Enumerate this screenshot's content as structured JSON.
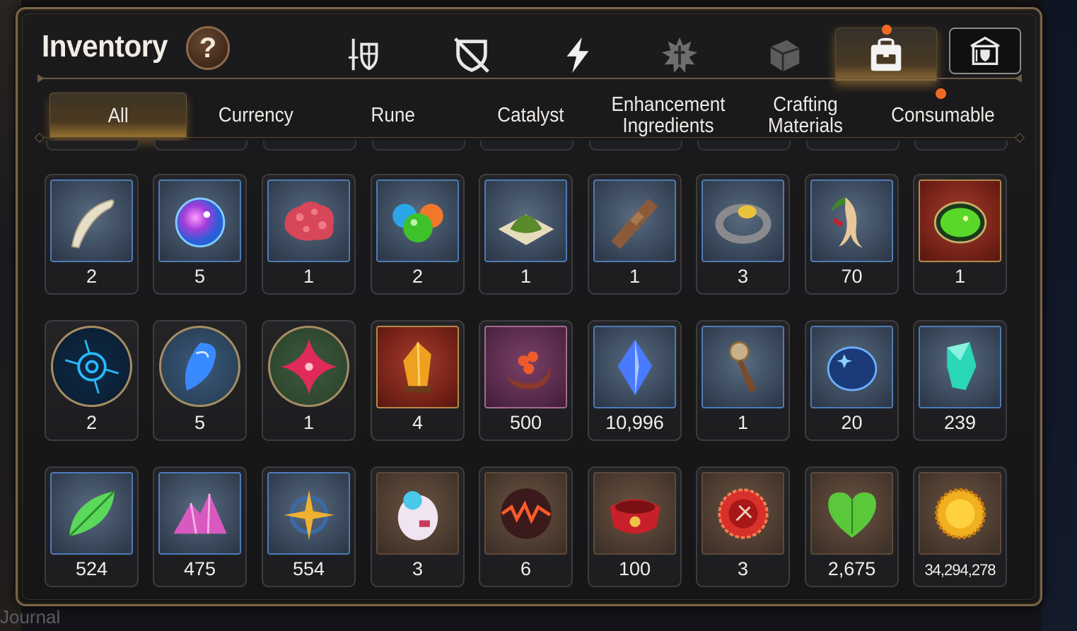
{
  "window": {
    "title": "Inventory",
    "help_label": "?"
  },
  "category_icons": [
    {
      "name": "weapon-armor-icon",
      "active": false
    },
    {
      "name": "no-shield-icon",
      "active": false
    },
    {
      "name": "lightning-icon",
      "active": false
    },
    {
      "name": "splat-cross-icon",
      "active": false
    },
    {
      "name": "cube-icon",
      "active": false
    },
    {
      "name": "backpack-icon",
      "active": true,
      "notification": true
    },
    {
      "name": "armory-shop-icon",
      "active": false
    }
  ],
  "filter_tabs": [
    {
      "label": "All",
      "active": true
    },
    {
      "label": "Currency",
      "active": false
    },
    {
      "label": "Rune",
      "active": false
    },
    {
      "label": "Catalyst",
      "active": false
    },
    {
      "label": "Enhancement Ingredients",
      "active": false
    },
    {
      "label": "Crafting Materials",
      "active": false
    },
    {
      "label": "Consumable",
      "active": false,
      "notification": true
    }
  ],
  "items": [
    [
      {
        "icon": "fang-icon",
        "count": "2"
      },
      {
        "icon": "purple-orb-icon",
        "count": "5"
      },
      {
        "icon": "red-blob-icon",
        "count": "1"
      },
      {
        "icon": "slime-orbs-icon",
        "count": "2"
      },
      {
        "icon": "green-powder-icon",
        "count": "1"
      },
      {
        "icon": "leather-strap-icon",
        "count": "1"
      },
      {
        "icon": "gem-ring-icon",
        "count": "3"
      },
      {
        "icon": "ginseng-root-icon",
        "count": "70"
      },
      {
        "icon": "green-potion-icon",
        "count": "1"
      }
    ],
    [
      {
        "icon": "blue-rune-disc-icon",
        "count": "2"
      },
      {
        "icon": "blue-crystal-shard-icon",
        "count": "5"
      },
      {
        "icon": "pink-star-gem-icon",
        "count": "1"
      },
      {
        "icon": "amber-crystal-icon",
        "count": "4"
      },
      {
        "icon": "crescent-flower-icon",
        "count": "500"
      },
      {
        "icon": "blue-diamond-icon",
        "count": "10,996"
      },
      {
        "icon": "compass-dagger-icon",
        "count": "1"
      },
      {
        "icon": "starry-orb-icon",
        "count": "20"
      },
      {
        "icon": "teal-crystal-icon",
        "count": "239"
      }
    ],
    [
      {
        "icon": "green-leaf-icon",
        "count": "524"
      },
      {
        "icon": "pink-crystals-icon",
        "count": "475"
      },
      {
        "icon": "star-amulet-icon",
        "count": "554"
      },
      {
        "icon": "robot-egg-icon",
        "count": "3"
      },
      {
        "icon": "lava-orb-icon",
        "count": "6"
      },
      {
        "icon": "red-bracelet-icon",
        "count": "100"
      },
      {
        "icon": "red-seal-icon",
        "count": "3"
      },
      {
        "icon": "green-heart-icon",
        "count": "2,675"
      },
      {
        "icon": "gold-coin-icon",
        "count": "34,294,278"
      }
    ]
  ],
  "background": {
    "bottom_text": "Journal"
  },
  "colors": {
    "accent_gold": "#9a7330",
    "notification": "#f26a22",
    "frame_blue": "#4e7bb8"
  }
}
